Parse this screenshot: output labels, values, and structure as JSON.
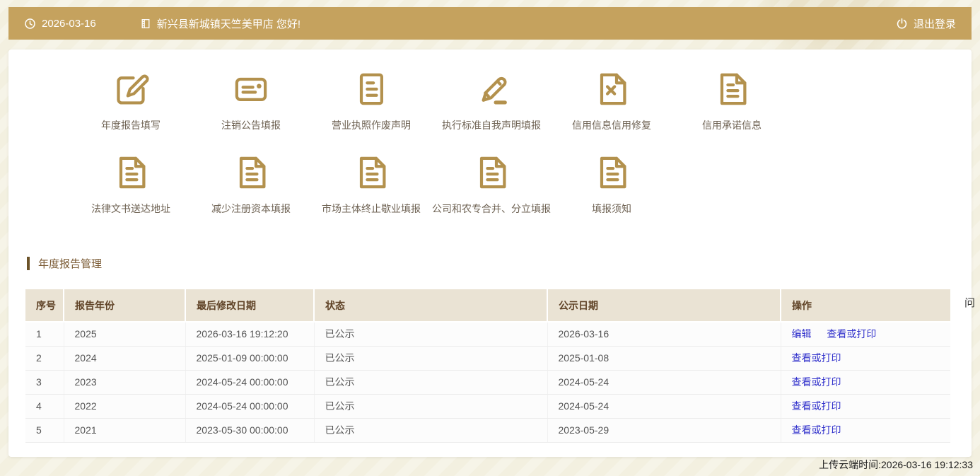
{
  "topbar": {
    "date": "2026-03-16",
    "greeting": "新兴县新城镇天竺美甲店 您好!",
    "logout_label": "退出登录",
    "bg_color": "#c5a25e"
  },
  "menu": {
    "icon_color": "#b3914d",
    "row1": [
      {
        "label": "年度报告填写",
        "icon": "edit-square-icon"
      },
      {
        "label": "注销公告填报",
        "icon": "card-lines-icon"
      },
      {
        "label": "营业执照作废声明",
        "icon": "doc-lines-icon"
      },
      {
        "label": "执行标准自我声明填报",
        "icon": "pencil-underline-icon"
      },
      {
        "label": "信用信息信用修复",
        "icon": "doc-x-icon"
      },
      {
        "label": "信用承诺信息",
        "icon": "doc-fold-lines-icon"
      }
    ],
    "row2": [
      {
        "label": "法律文书送达地址",
        "icon": "doc-fold-lines-icon"
      },
      {
        "label": "减少注册资本填报",
        "icon": "doc-fold-lines-icon"
      },
      {
        "label": "市场主体终止歇业填报",
        "icon": "doc-fold-lines-icon"
      },
      {
        "label": "公司和农专合并、分立填报",
        "icon": "doc-fold-lines-icon"
      },
      {
        "label": "填报须知",
        "icon": "doc-fold-lines-icon"
      }
    ]
  },
  "report_section": {
    "title": "年度报告管理",
    "table": {
      "headers": [
        "序号",
        "报告年份",
        "最后修改日期",
        "状态",
        "公示日期",
        "操作"
      ],
      "rows": [
        {
          "seq": "1",
          "year": "2025",
          "modified": "2026-03-16 19:12:20",
          "status": "已公示",
          "publish": "2026-03-16",
          "actions": [
            "编辑",
            "查看或打印"
          ]
        },
        {
          "seq": "2",
          "year": "2024",
          "modified": "2025-01-09 00:00:00",
          "status": "已公示",
          "publish": "2025-01-08",
          "actions": [
            "查看或打印"
          ]
        },
        {
          "seq": "3",
          "year": "2023",
          "modified": "2024-05-24 00:00:00",
          "status": "已公示",
          "publish": "2024-05-24",
          "actions": [
            "查看或打印"
          ]
        },
        {
          "seq": "4",
          "year": "2022",
          "modified": "2024-05-24 00:00:00",
          "status": "已公示",
          "publish": "2024-05-24",
          "actions": [
            "查看或打印"
          ]
        },
        {
          "seq": "5",
          "year": "2021",
          "modified": "2023-05-30 00:00:00",
          "status": "已公示",
          "publish": "2023-05-29",
          "actions": [
            "查看或打印"
          ]
        }
      ]
    }
  },
  "footer": {
    "upload_time": "上传云端时间:2026-03-16 19:12:33"
  },
  "side_widget": {
    "label": "问"
  }
}
